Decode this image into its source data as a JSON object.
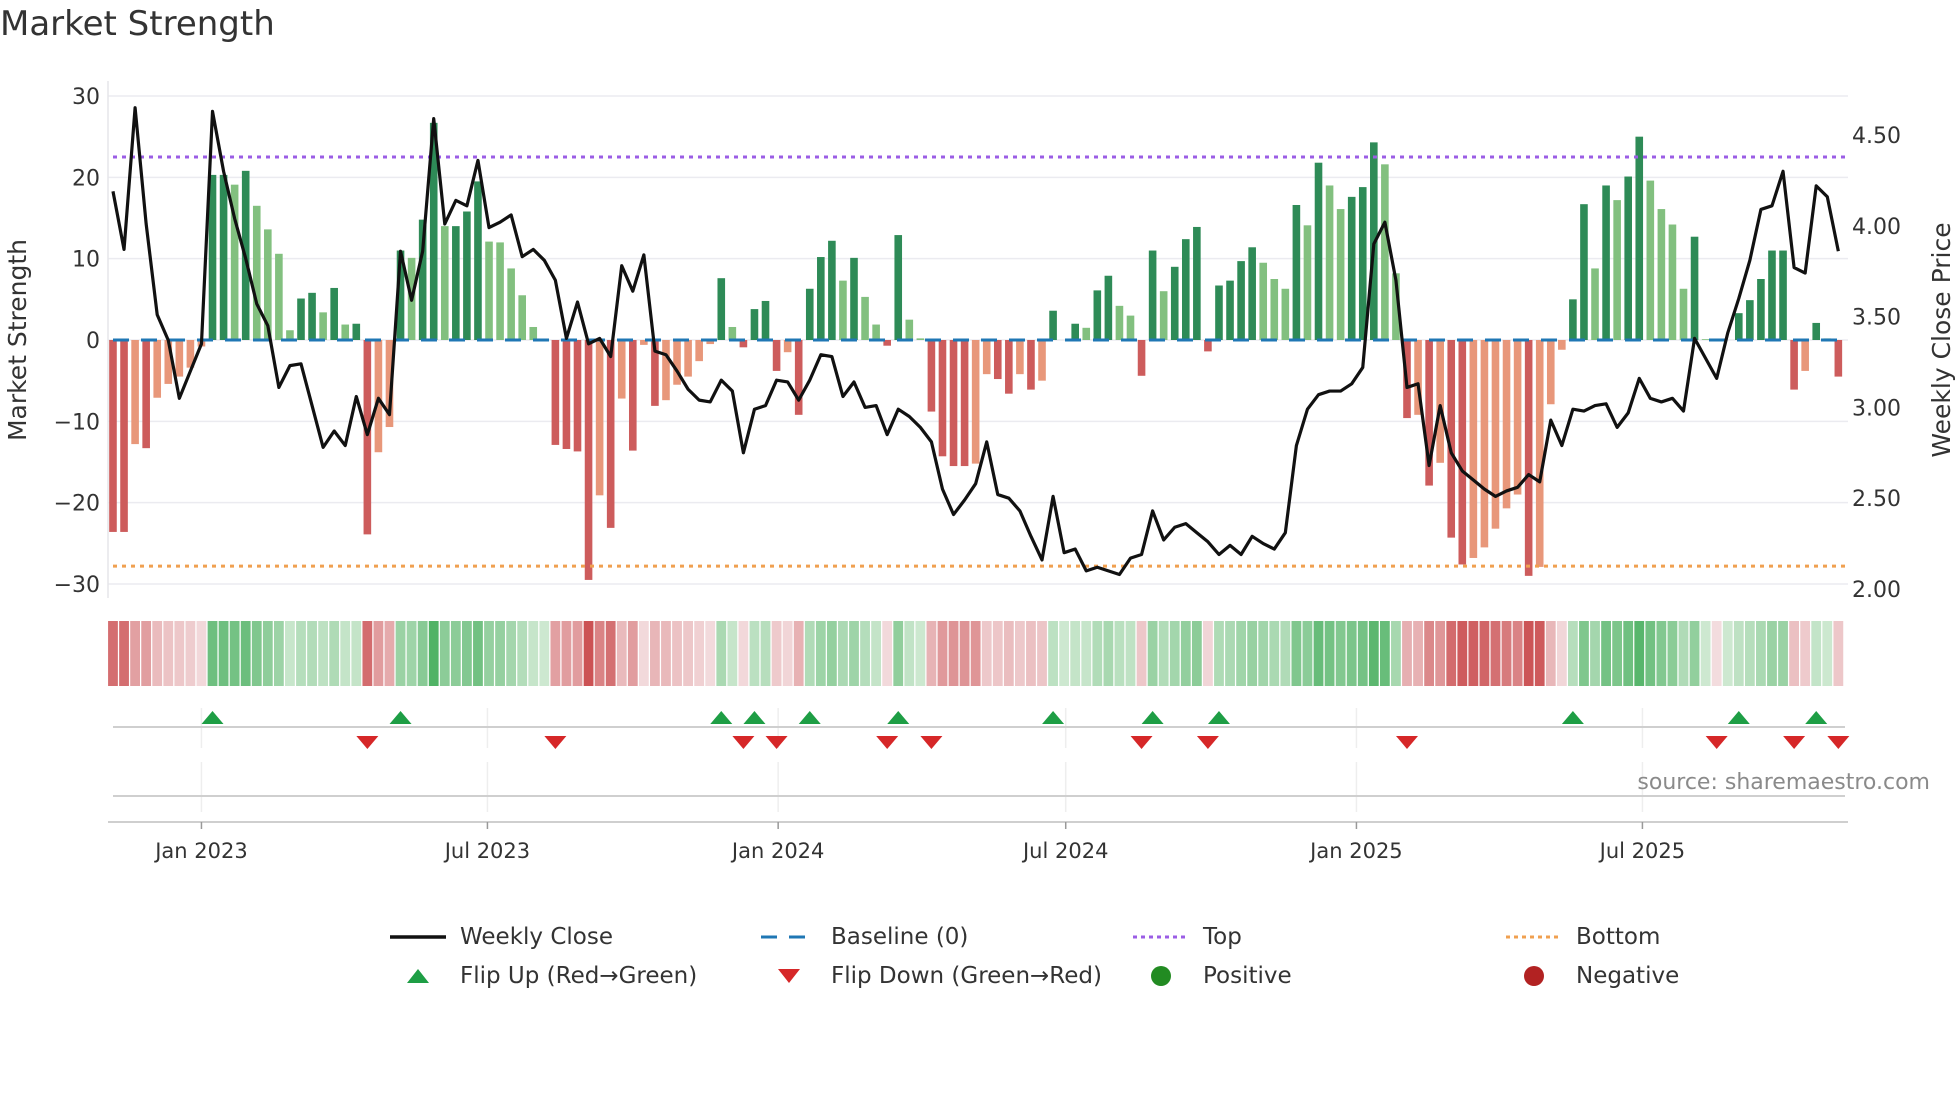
{
  "title": "Market Strength",
  "source": "source: sharemaestro.com",
  "colors": {
    "pos_strong": "#2e8b57",
    "pos_weak": "#82c07f",
    "neg_strong": "#cd5c5c",
    "neg_weak": "#e8977a",
    "baseline": "#1f77b4",
    "top": "#9b5de5",
    "bottom": "#f0a050",
    "flip_up": "#1e9e45",
    "flip_down": "#d62728",
    "positive": "#228b22",
    "negative": "#b22222",
    "close": "#111111"
  },
  "legend": [
    {
      "key": "close",
      "label": "Weekly Close"
    },
    {
      "key": "baseline",
      "label": "Baseline (0)"
    },
    {
      "key": "top",
      "label": "Top"
    },
    {
      "key": "bottom",
      "label": "Bottom"
    },
    {
      "key": "flip_up",
      "label": "Flip Up (Red→Green)"
    },
    {
      "key": "flip_down",
      "label": "Flip Down (Green→Red)"
    },
    {
      "key": "positive",
      "label": "Positive"
    },
    {
      "key": "negative",
      "label": "Negative"
    }
  ],
  "chart_data": {
    "type": "bar+line",
    "title": "Market Strength",
    "ylabel": "Market Strength",
    "y2label": "Weekly Close Price",
    "ylim": [
      -31.7,
      31.8
    ],
    "y2lim": [
      1.95,
      4.8
    ],
    "yticks": [
      -30,
      -20,
      -10,
      0,
      10,
      20,
      30
    ],
    "ytick_labels": [
      "−30",
      "−20",
      "−10",
      "0",
      "10",
      "20",
      "30"
    ],
    "y2ticks": [
      2.0,
      2.5,
      3.0,
      3.5,
      4.0,
      4.5
    ],
    "y2tick_labels": [
      "2.00",
      "2.50",
      "3.00",
      "3.50",
      "4.00",
      "4.50"
    ],
    "xticks": [
      "2023-01-01",
      "2023-07-01",
      "2024-01-01",
      "2024-07-01",
      "2025-01-01",
      "2025-07-01"
    ],
    "xtick_labels": [
      "Jan 2023",
      "Jul 2023",
      "Jan 2024",
      "Jul 2024",
      "Jan 2025",
      "Jul 2025"
    ],
    "first_week": "2022-11-06",
    "grid": true,
    "top_line": 22.5,
    "bottom_line": -27.8,
    "strength": [
      -23.6,
      -23.6,
      -12.8,
      -13.3,
      -7.1,
      -5.4,
      -4.5,
      -3.4,
      -0.8,
      20.3,
      20.3,
      19.1,
      20.8,
      16.5,
      13.6,
      10.6,
      1.2,
      5.1,
      5.8,
      3.4,
      6.4,
      1.9,
      2.0,
      -23.9,
      -13.8,
      -10.7,
      11.0,
      10.1,
      14.8,
      26.7,
      14.0,
      14.0,
      15.8,
      19.5,
      12.1,
      12.0,
      8.8,
      5.5,
      1.6,
      0,
      -12.9,
      -13.4,
      -13.7,
      -29.5,
      -19.1,
      -23.1,
      -7.2,
      -13.6,
      -0.6,
      -8.1,
      -7.4,
      -5.5,
      -4.5,
      -2.6,
      -0.5,
      7.6,
      1.6,
      -0.9,
      3.8,
      4.8,
      -3.8,
      -1.5,
      -9.2,
      6.3,
      10.2,
      12.2,
      7.3,
      10.1,
      5.3,
      1.9,
      -0.7,
      12.9,
      2.5,
      0.2,
      -8.8,
      -14.3,
      -15.5,
      -15.5,
      -15.2,
      -4.2,
      -4.8,
      -6.6,
      -4.2,
      -6.1,
      -5.0,
      3.6,
      0,
      2.0,
      1.5,
      6.1,
      7.9,
      4.2,
      3.0,
      -4.4,
      11.0,
      6.0,
      9.0,
      12.4,
      13.9,
      -1.4,
      6.7,
      7.3,
      9.7,
      11.4,
      9.5,
      7.5,
      6.3,
      16.6,
      14.1,
      21.8,
      19.0,
      16.1,
      17.6,
      18.8,
      24.3,
      21.6,
      8.2,
      -9.6,
      -9.2,
      -17.9,
      -15.1,
      -24.3,
      -27.6,
      -26.8,
      -25.5,
      -23.2,
      -20.7,
      -19.0,
      -29.0,
      -27.9,
      -7.9,
      -1.2,
      5.0,
      16.7,
      8.8,
      19.0,
      17.2,
      20.1,
      25.0,
      19.6,
      16.1,
      14.2,
      6.3,
      12.7,
      0.1,
      -0.1,
      0,
      3.3,
      4.9,
      7.5,
      11.0,
      11.0,
      -6.1,
      -3.8,
      2.1,
      0.2,
      -4.5
    ],
    "close": [
      4.19,
      3.87,
      4.65,
      4.01,
      3.51,
      3.37,
      3.05,
      3.2,
      3.35,
      4.63,
      4.3,
      4.04,
      3.82,
      3.57,
      3.45,
      3.11,
      3.23,
      3.24,
      3.01,
      2.78,
      2.87,
      2.79,
      3.06,
      2.85,
      3.05,
      2.96,
      3.86,
      3.59,
      3.86,
      4.59,
      4.01,
      4.14,
      4.11,
      4.36,
      3.99,
      4.02,
      4.06,
      3.83,
      3.87,
      3.81,
      3.7,
      3.38,
      3.58,
      3.35,
      3.38,
      3.28,
      3.78,
      3.64,
      3.84,
      3.31,
      3.29,
      3.2,
      3.1,
      3.04,
      3.03,
      3.15,
      3.09,
      2.75,
      2.99,
      3.01,
      3.15,
      3.14,
      3.04,
      3.15,
      3.29,
      3.28,
      3.06,
      3.14,
      3.0,
      3.01,
      2.85,
      2.99,
      2.95,
      2.89,
      2.81,
      2.55,
      2.41,
      2.49,
      2.58,
      2.81,
      2.52,
      2.5,
      2.43,
      2.29,
      2.16,
      2.51,
      2.2,
      2.22,
      2.1,
      2.12,
      2.1,
      2.08,
      2.17,
      2.19,
      2.43,
      2.27,
      2.34,
      2.36,
      2.31,
      2.26,
      2.19,
      2.24,
      2.19,
      2.29,
      2.25,
      2.22,
      2.31,
      2.79,
      2.99,
      3.07,
      3.09,
      3.09,
      3.13,
      3.22,
      3.9,
      4.02,
      3.7,
      3.11,
      3.13,
      2.68,
      3.01,
      2.75,
      2.65,
      2.6,
      2.55,
      2.51,
      2.54,
      2.56,
      2.63,
      2.59,
      2.93,
      2.79,
      2.99,
      2.98,
      3.01,
      3.02,
      2.89,
      2.97,
      3.16,
      3.05,
      3.03,
      3.05,
      2.98,
      3.38,
      3.27,
      3.16,
      3.41,
      3.6,
      3.81,
      4.09,
      4.11,
      4.3,
      3.77,
      3.74,
      4.22,
      4.16,
      3.86
    ],
    "flip_up_weeks": [
      10,
      27,
      56,
      59,
      64,
      72,
      86,
      95,
      101,
      133,
      148,
      155
    ],
    "flip_down_weeks": [
      24,
      41,
      58,
      61,
      71,
      75,
      94,
      100,
      118,
      146,
      153,
      157
    ]
  }
}
